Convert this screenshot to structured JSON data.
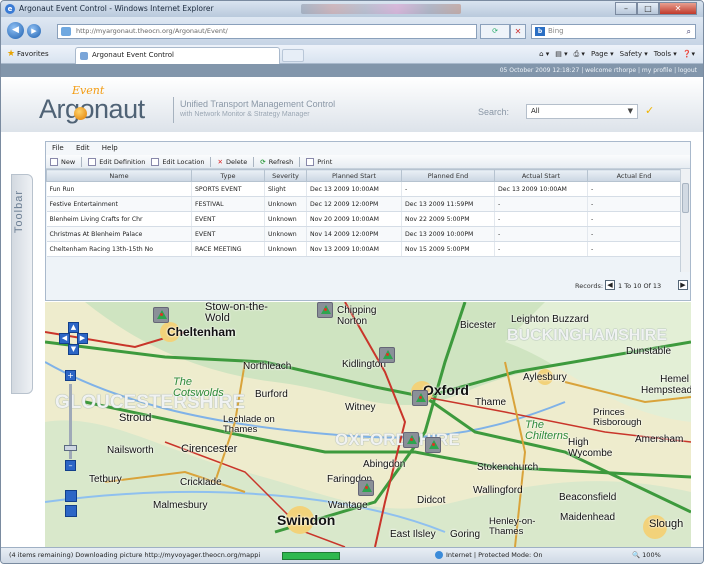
{
  "browser": {
    "title": "Argonaut Event Control - Windows Internet Explorer",
    "url": "http://myargonaut.theocn.org/Argonaut/Event/",
    "search_placeholder": "Bing",
    "favorites_label": "Favorites",
    "tab_label": "Argonaut Event Control",
    "commands": [
      "Page ▾",
      "Safety ▾",
      "Tools ▾"
    ],
    "status_text": "(4 items remaining) Downloading picture http://myvoyager.theocn.org/mappi",
    "status_progress_fraction": 0.6,
    "zone_text": "Internet | Protected Mode: On",
    "zoom_text": "100%"
  },
  "app": {
    "userbar_text": "05 October 2009 12:18:27 | welcome rthorpe | my profile | logout",
    "logo_event": "Event",
    "logo_main": "Argonaut",
    "subtitle1": "Unified Transport Management Control",
    "subtitle2": "with Network Monitor & Strategy Manager",
    "search_label": "Search:",
    "search_value": "All",
    "toolbar_tab": "Toolbar"
  },
  "menu": [
    "File",
    "Edit",
    "Help"
  ],
  "tools": {
    "new": "New",
    "edit_definition": "Edit Definition",
    "edit_location": "Edit Location",
    "delete": "Delete",
    "refresh": "Refresh",
    "print": "Print"
  },
  "grid": {
    "columns": [
      "Name",
      "Type",
      "Severity",
      "Planned Start",
      "Planned End",
      "Actual Start",
      "Actual End"
    ],
    "rows": [
      [
        "Fun Run",
        "SPORTS EVENT",
        "Slight",
        "Dec 13 2009 10:00AM",
        "-",
        "Dec 13 2009 10:00AM",
        "-"
      ],
      [
        "Festive Entertainment",
        "FESTIVAL",
        "Unknown",
        "Dec 12 2009 12:00PM",
        "Dec 13 2009 11:59PM",
        "-",
        "-"
      ],
      [
        "Blenheim Living Crafts for Chr",
        "EVENT",
        "Unknown",
        "Nov 20 2009 10:00AM",
        "Nov 22 2009 5:00PM",
        "-",
        "-"
      ],
      [
        "Christmas At Blenheim Palace",
        "EVENT",
        "Unknown",
        "Nov 14 2009 12:00PM",
        "Dec 13 2009 10:00PM",
        "-",
        "-"
      ],
      [
        "Cheltenham Racing 13th-15th No",
        "RACE MEETING",
        "Unknown",
        "Nov 13 2009 10:00AM",
        "Nov 15 2009 5:00PM",
        "-",
        "-"
      ]
    ],
    "records_label": "Records:",
    "records_info": "1 To 10 Of 13"
  },
  "map": {
    "towns": [
      {
        "name": "Stow-on-the-Wold"
      },
      {
        "name": "Cheltenham"
      },
      {
        "name": "Northleach"
      },
      {
        "name": "Burford"
      },
      {
        "name": "Stroud"
      },
      {
        "name": "Lechlade on Thames"
      },
      {
        "name": "Nailsworth"
      },
      {
        "name": "Cirencester"
      },
      {
        "name": "Tetbury"
      },
      {
        "name": "Cricklade"
      },
      {
        "name": "Malmesbury"
      },
      {
        "name": "Swindon"
      },
      {
        "name": "Chipping Norton"
      },
      {
        "name": "Kidlington"
      },
      {
        "name": "Oxford"
      },
      {
        "name": "Witney"
      },
      {
        "name": "Abingdon"
      },
      {
        "name": "Faringdon"
      },
      {
        "name": "Wantage"
      },
      {
        "name": "Didcot"
      },
      {
        "name": "Bicester"
      },
      {
        "name": "Leighton Buzzard"
      },
      {
        "name": "Dunstable"
      },
      {
        "name": "Aylesbury"
      },
      {
        "name": "Thame"
      },
      {
        "name": "Princes Risborough"
      },
      {
        "name": "Hemel Hempstead"
      },
      {
        "name": "High Wycombe"
      },
      {
        "name": "Amersham"
      },
      {
        "name": "Stokenchurch"
      },
      {
        "name": "Wallingford"
      },
      {
        "name": "Beaconsfield"
      },
      {
        "name": "Maidenhead"
      },
      {
        "name": "Henley-on-Thames"
      },
      {
        "name": "Goring"
      },
      {
        "name": "East Ilsley"
      },
      {
        "name": "Slough"
      },
      {
        "name": "The Cotswolds"
      },
      {
        "name": "The Chilterns"
      }
    ],
    "regions": [
      "GLOUCESTERSHIRE",
      "OXFORDSHIRE",
      "BUCKINGHAMSHIRE"
    ]
  }
}
